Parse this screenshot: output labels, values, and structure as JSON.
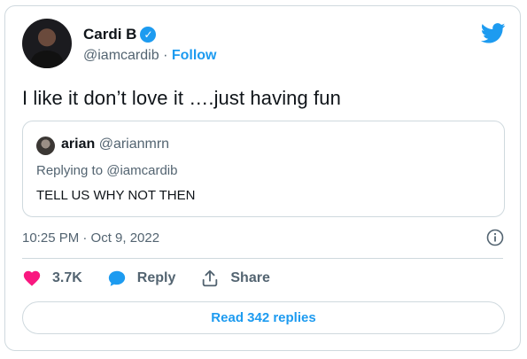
{
  "author": {
    "name": "Cardi B",
    "handle": "@iamcardib",
    "separator": "·",
    "follow_label": "Follow",
    "verified": true
  },
  "tweet": {
    "text": "I like it don’t love it ….just having fun",
    "timestamp": "10:25 PM · Oct 9, 2022"
  },
  "quoted_tweet": {
    "name": "arian",
    "handle": "@arianmrn",
    "replying_to": "Replying to @iamcardib",
    "text": "TELL US WHY NOT THEN"
  },
  "actions": {
    "like_count": "3.7K",
    "reply_label": "Reply",
    "share_label": "Share"
  },
  "read_replies_label": "Read 342 replies",
  "colors": {
    "accent": "#1d9bf0",
    "like": "#f91880",
    "muted": "#536471",
    "border": "#cfd9de"
  },
  "icons": [
    "twitter-bird-icon",
    "verified-badge-icon",
    "info-icon",
    "heart-icon",
    "reply-bubble-icon",
    "share-icon"
  ]
}
